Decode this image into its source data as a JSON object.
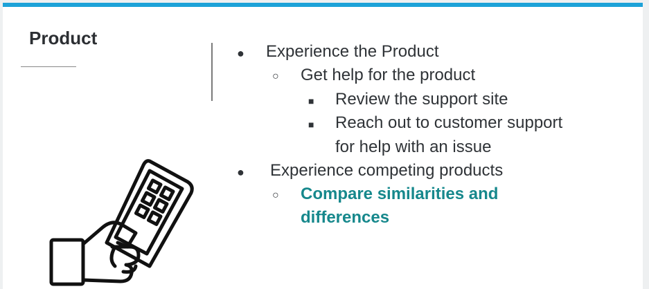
{
  "slide": {
    "title": "Product",
    "bullets": [
      {
        "text": "Experience the Product"
      },
      {
        "text": "Get help for the product"
      },
      {
        "text": "Review the support site"
      },
      {
        "text": "Reach out to customer support",
        "text2": "for help with an issue"
      },
      {
        "text": "Experience competing products"
      },
      {
        "text": "Compare similarities and",
        "text2": "differences"
      }
    ],
    "colors": {
      "accent_bar": "#1da2d8",
      "highlight": "#16888c",
      "text": "#2f3337"
    },
    "illustration": "hand-holding-phone-icon"
  }
}
